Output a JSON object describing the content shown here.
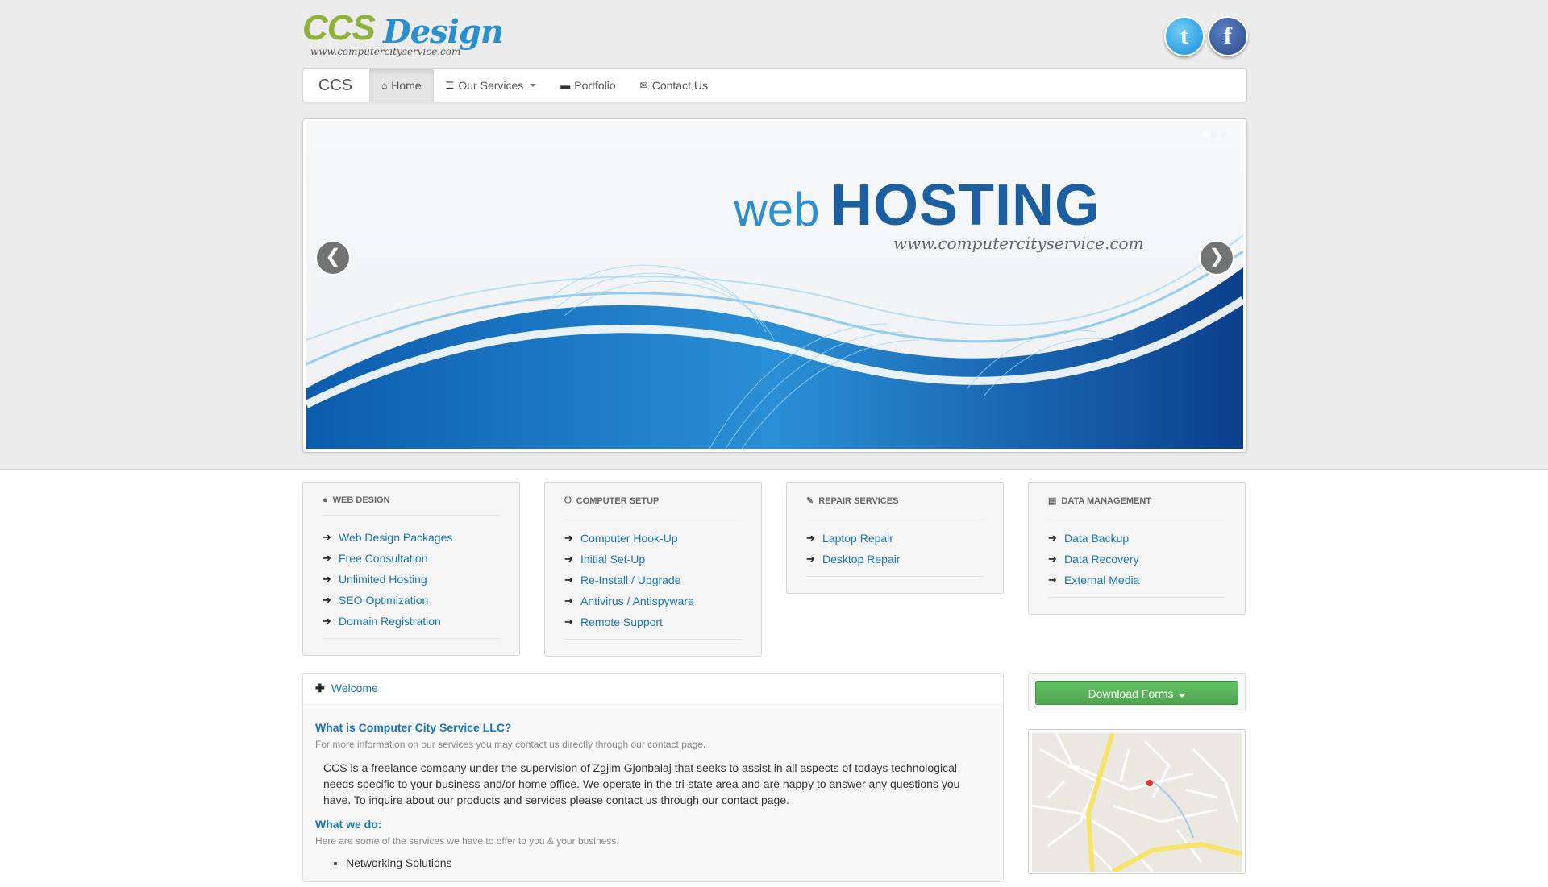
{
  "header": {
    "logo_main": "CCS",
    "logo_design": "Design",
    "logo_url": "www.computercityservice.com",
    "social": [
      {
        "icon": "twitter-icon",
        "glyph": "t"
      },
      {
        "icon": "facebook-icon",
        "glyph": "f"
      }
    ]
  },
  "navbar": {
    "brand": "CCS",
    "items": [
      {
        "label": "Home",
        "icon": "home-icon",
        "glyph": "⌂",
        "active": true
      },
      {
        "label": "Our Services",
        "icon": "list-icon",
        "glyph": "☰",
        "dropdown": true
      },
      {
        "label": "Portfolio",
        "icon": "briefcase-icon",
        "glyph": "▬"
      },
      {
        "label": "Contact Us",
        "icon": "envelope-icon",
        "glyph": "✉"
      }
    ]
  },
  "slider": {
    "word_web": "web",
    "word_hosting": "HOSTING",
    "url": "www.computercityservice.com",
    "prev": "❮",
    "next": "❯",
    "dots": 3
  },
  "services": [
    {
      "title": "Web Design",
      "icon": "globe-icon",
      "glyph": "●",
      "links": [
        "Web Design Packages",
        "Free Consultation",
        "Unlimited Hosting",
        "SEO Optimization",
        "Domain Registration"
      ]
    },
    {
      "title": "Computer Setup",
      "icon": "power-icon",
      "glyph": "⏻",
      "links": [
        "Computer Hook-Up",
        "Initial Set-Up",
        "Re-Install / Upgrade",
        "Antivirus / Antispyware",
        "Remote Support"
      ]
    },
    {
      "title": "Repair Services",
      "icon": "wrench-icon",
      "glyph": "✎",
      "links": [
        "Laptop Repair",
        "Desktop Repair"
      ]
    },
    {
      "title": "Data Management",
      "icon": "hdd-icon",
      "glyph": "▤",
      "links": [
        "Data Backup",
        "Data Recovery",
        "External Media"
      ]
    }
  ],
  "welcome": {
    "tab_label": "Welcome",
    "q1": "What is Computer City Service LLC?",
    "sub1": "For more information on our services you may contact us directly through our contact page.",
    "para": "CCS is a freelance company under the supervision of Zgjim Gjonbalaj that seeks to assist in all aspects of todays technological needs specific to your business and/or home office. We operate in the tri-state area and are happy to answer any questions you have. To inquire about our products and services please contact us through our contact page.",
    "q2": "What we do:",
    "sub2": "Here are some of the services we have to offer to you & your business.",
    "bullets": [
      "Networking Solutions"
    ]
  },
  "sidebar": {
    "download_label": "Download Forms"
  },
  "colors": {
    "link": "#1a75bb",
    "green_button": "#51a351",
    "hosting_blue": "#1b5fa0"
  }
}
